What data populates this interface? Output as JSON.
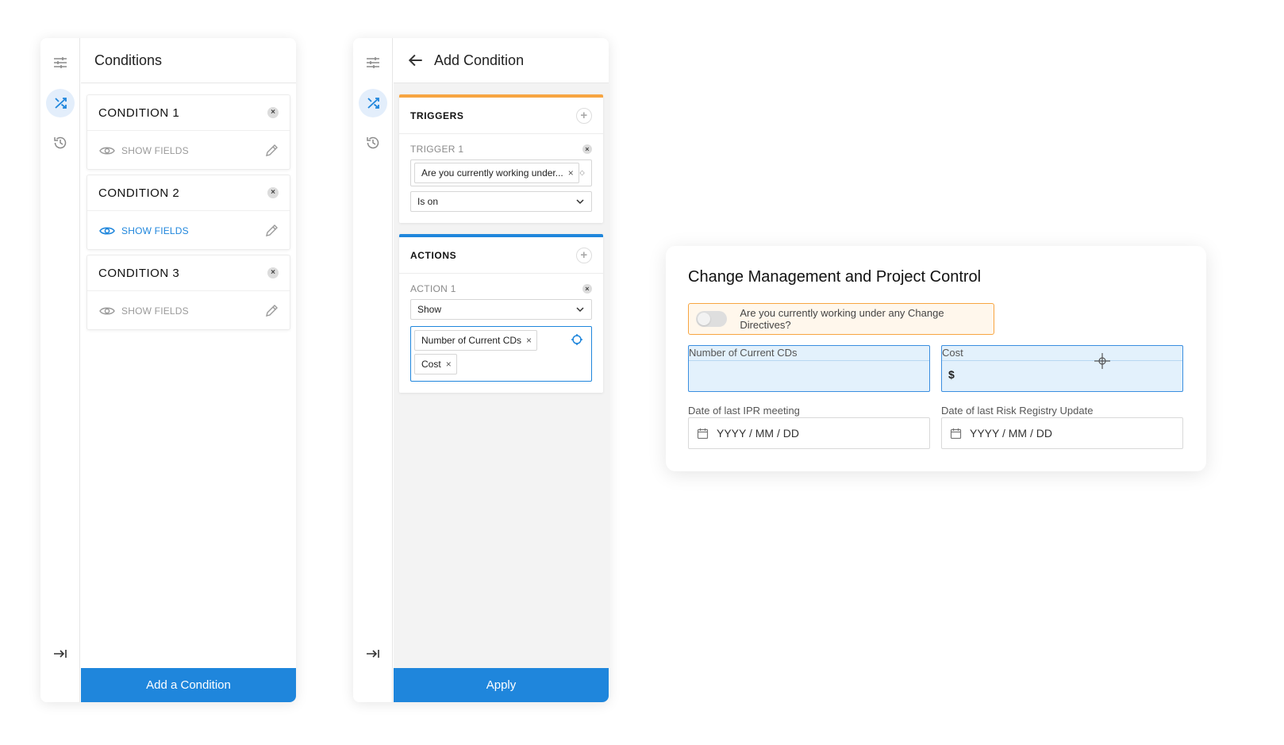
{
  "conditions_panel": {
    "title": "Conditions",
    "conditions": [
      {
        "title": "CONDITION 1",
        "show_fields": "SHOW FIELDS"
      },
      {
        "title": "CONDITION 2",
        "show_fields": "SHOW FIELDS"
      },
      {
        "title": "CONDITION 3",
        "show_fields": "SHOW FIELDS"
      }
    ],
    "footer_button": "Add a Condition"
  },
  "add_condition_panel": {
    "title": "Add Condition",
    "triggers": {
      "heading": "TRIGGERS",
      "trigger_label": "TRIGGER 1",
      "field_chip": "Are you currently working under...",
      "operator": "Is on"
    },
    "actions": {
      "heading": "ACTIONS",
      "action_label": "ACTION 1",
      "action_type": "Show",
      "field_chips": [
        "Number of Current CDs",
        "Cost"
      ]
    },
    "footer_button": "Apply"
  },
  "form": {
    "title": "Change Management and Project Control",
    "toggle_question": "Are you currently working under any Change Directives?",
    "toggle_on": false,
    "field_current_cds": "Number of Current CDs",
    "field_cost": "Cost",
    "cost_prefix": "$",
    "date_ipr_label": "Date of last IPR meeting",
    "date_ipr_placeholder": "YYYY / MM / DD",
    "date_risk_label": "Date of last Risk Registry Update",
    "date_risk_placeholder": "YYYY / MM / DD"
  },
  "colors": {
    "accent_blue": "#1f86dc",
    "trigger_orange": "#f7a541",
    "highlight_fill": "#e3f1fc"
  }
}
